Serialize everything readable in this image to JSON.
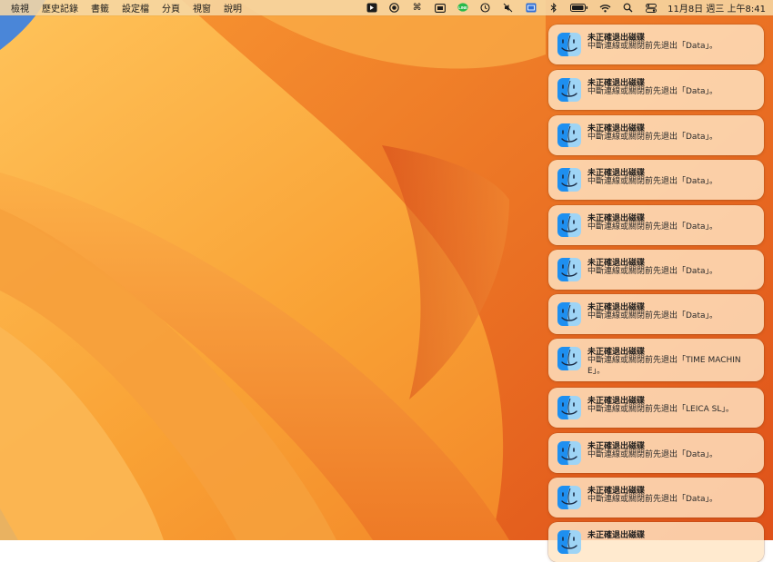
{
  "menubar": {
    "items": [
      "檢視",
      "歷史記錄",
      "書籤",
      "設定檔",
      "分頁",
      "視窗",
      "說明"
    ],
    "status_icons": [
      {
        "name": "app-indicator-icon",
        "glyph": "ᐅ"
      },
      {
        "name": "screen-record-icon",
        "glyph": "◉"
      },
      {
        "name": "command-icon",
        "glyph": "⌘"
      },
      {
        "name": "display-icon",
        "glyph": "▭"
      },
      {
        "name": "line-app-icon",
        "glyph": "LINE"
      },
      {
        "name": "time-machine-icon",
        "glyph": "⟲"
      },
      {
        "name": "mute-icon",
        "glyph": "✕"
      },
      {
        "name": "keyboard-input-icon",
        "glyph": "⌨"
      },
      {
        "name": "bluetooth-icon",
        "glyph": "ᛒ"
      },
      {
        "name": "battery-icon",
        "glyph": ""
      },
      {
        "name": "wifi-icon",
        "glyph": ""
      },
      {
        "name": "spotlight-search-icon",
        "glyph": ""
      },
      {
        "name": "control-center-icon",
        "glyph": ""
      }
    ],
    "clock": "11月8日 週三 上午8:41"
  },
  "notifications": [
    {
      "title": "未正確退出磁碟",
      "body": "中斷連線或關閉前先退出「Data」。"
    },
    {
      "title": "未正確退出磁碟",
      "body": "中斷連線或關閉前先退出「Data」。"
    },
    {
      "title": "未正確退出磁碟",
      "body": "中斷連線或關閉前先退出「Data」。"
    },
    {
      "title": "未正確退出磁碟",
      "body": "中斷連線或關閉前先退出「Data」。"
    },
    {
      "title": "未正確退出磁碟",
      "body": "中斷連線或關閉前先退出「Data」。"
    },
    {
      "title": "未正確退出磁碟",
      "body": "中斷連線或關閉前先退出「Data」。"
    },
    {
      "title": "未正確退出磁碟",
      "body": "中斷連線或關閉前先退出「Data」。"
    },
    {
      "title": "未正確退出磁碟",
      "body": "中斷連線或關閉前先退出「TIME MACHINE」。"
    },
    {
      "title": "未正確退出磁碟",
      "body": "中斷連線或關閉前先退出「LEICA SL」。"
    },
    {
      "title": "未正確退出磁碟",
      "body": "中斷連線或關閉前先退出「Data」。"
    },
    {
      "title": "未正確退出磁碟",
      "body": "中斷連線或關閉前先退出「Data」。"
    },
    {
      "title": "未正確退出磁碟",
      "body": ""
    }
  ],
  "colors": {
    "wallpaper_light": "#ffb347",
    "wallpaper_mid": "#f7982a",
    "wallpaper_dark": "#d9461a",
    "wallpaper_blue": "#4a86d8"
  }
}
